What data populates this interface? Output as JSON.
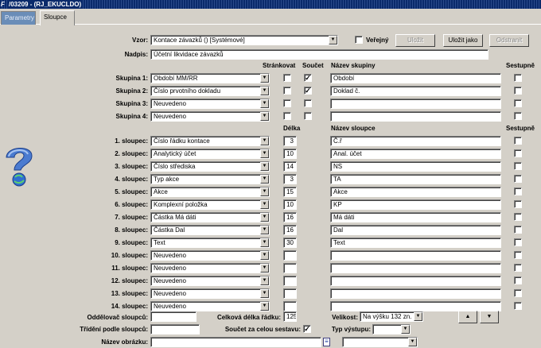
{
  "window": {
    "title": "/03209 - (RJ_EKUCLDO)",
    "logo": "F"
  },
  "tabs": [
    {
      "label": "Parametry"
    },
    {
      "label": "Sloupce"
    }
  ],
  "vzor": {
    "label": "Vzor:",
    "value": "Kontace závazků  ()  [Systémové]",
    "public_label": "Veřejný",
    "public_checked": false
  },
  "buttons": {
    "save": "Uložit",
    "save_as": "Uložit jako",
    "remove": "Odstranit"
  },
  "nadpis": {
    "label": "Nadpis:",
    "value": "Účetní likvidace závazků"
  },
  "group_headers": {
    "page": "Stránkovat",
    "sum": "Součet",
    "name": "Název skupiny",
    "desc": "Sestupně"
  },
  "groups": [
    {
      "label": "Skupina 1:",
      "value": "Období MM/RR",
      "page": false,
      "sum": true,
      "name": "Období",
      "desc": false
    },
    {
      "label": "Skupina 2:",
      "value": "Číslo prvotního dokladu",
      "page": false,
      "sum": true,
      "name": "Doklad č.",
      "desc": false
    },
    {
      "label": "Skupina 3:",
      "value": "Neuvedeno",
      "page": false,
      "sum": false,
      "name": "",
      "desc": false
    },
    {
      "label": "Skupina 4:",
      "value": "Neuvedeno",
      "page": false,
      "sum": false,
      "name": "",
      "desc": false
    }
  ],
  "column_headers": {
    "length": "Délka",
    "name": "Název sloupce",
    "desc": "Sestupně"
  },
  "columns": [
    {
      "label": "1. sloupec:",
      "value": "Číslo řádku kontace",
      "length": "3",
      "name": "Č.ř",
      "desc": false
    },
    {
      "label": "2. sloupec:",
      "value": "Analytický účet",
      "length": "10",
      "name": "Anal. účet",
      "desc": false
    },
    {
      "label": "3. sloupec:",
      "value": "Číslo střediska",
      "length": "14",
      "name": "NS",
      "desc": false
    },
    {
      "label": "4. sloupec:",
      "value": "Typ akce",
      "length": "3",
      "name": "TA",
      "desc": false
    },
    {
      "label": "5. sloupec:",
      "value": "Akce",
      "length": "15",
      "name": "Akce",
      "desc": false
    },
    {
      "label": "6. sloupec:",
      "value": "Komplexní položka",
      "length": "10",
      "name": "KP",
      "desc": false
    },
    {
      "label": "7. sloupec:",
      "value": "Částka Má dáti",
      "length": "16",
      "name": "Má dáti",
      "desc": false
    },
    {
      "label": "8. sloupec:",
      "value": "Částka Dal",
      "length": "16",
      "name": "Dal",
      "desc": false
    },
    {
      "label": "9. sloupec:",
      "value": "Text",
      "length": "30",
      "name": "Text",
      "desc": false
    },
    {
      "label": "10. sloupec:",
      "value": "Neuvedeno",
      "length": "",
      "name": "",
      "desc": false
    },
    {
      "label": "11. sloupec:",
      "value": "Neuvedeno",
      "length": "",
      "name": "",
      "desc": false
    },
    {
      "label": "12. sloupec:",
      "value": "Neuvedeno",
      "length": "",
      "name": "",
      "desc": false
    },
    {
      "label": "13. sloupec:",
      "value": "Neuvedeno",
      "length": "",
      "name": "",
      "desc": false
    },
    {
      "label": "14. sloupec:",
      "value": "Neuvedeno",
      "length": "",
      "name": "",
      "desc": false
    }
  ],
  "footer": {
    "separator_label": "Oddělovač sloupců:",
    "separator_value": "",
    "total_label": "Celková délka řádku:",
    "total_value": "125",
    "size_label": "Velikost:",
    "size_value": "Na výšku 132 zn.",
    "sort_label": "Třídění podle sloupců:",
    "sort_value": "",
    "sum_all_label": "Součet za celou sestavu:",
    "sum_all_checked": true,
    "output_label": "Typ výstupu:",
    "output_value": "",
    "image_label": "Název obrázku:",
    "image_value": "",
    "image_select_value": ""
  },
  "colors": {
    "titlebar": "#0a2a6b",
    "tab_inactive": "#6a8db8",
    "background": "#d4d0c8"
  }
}
